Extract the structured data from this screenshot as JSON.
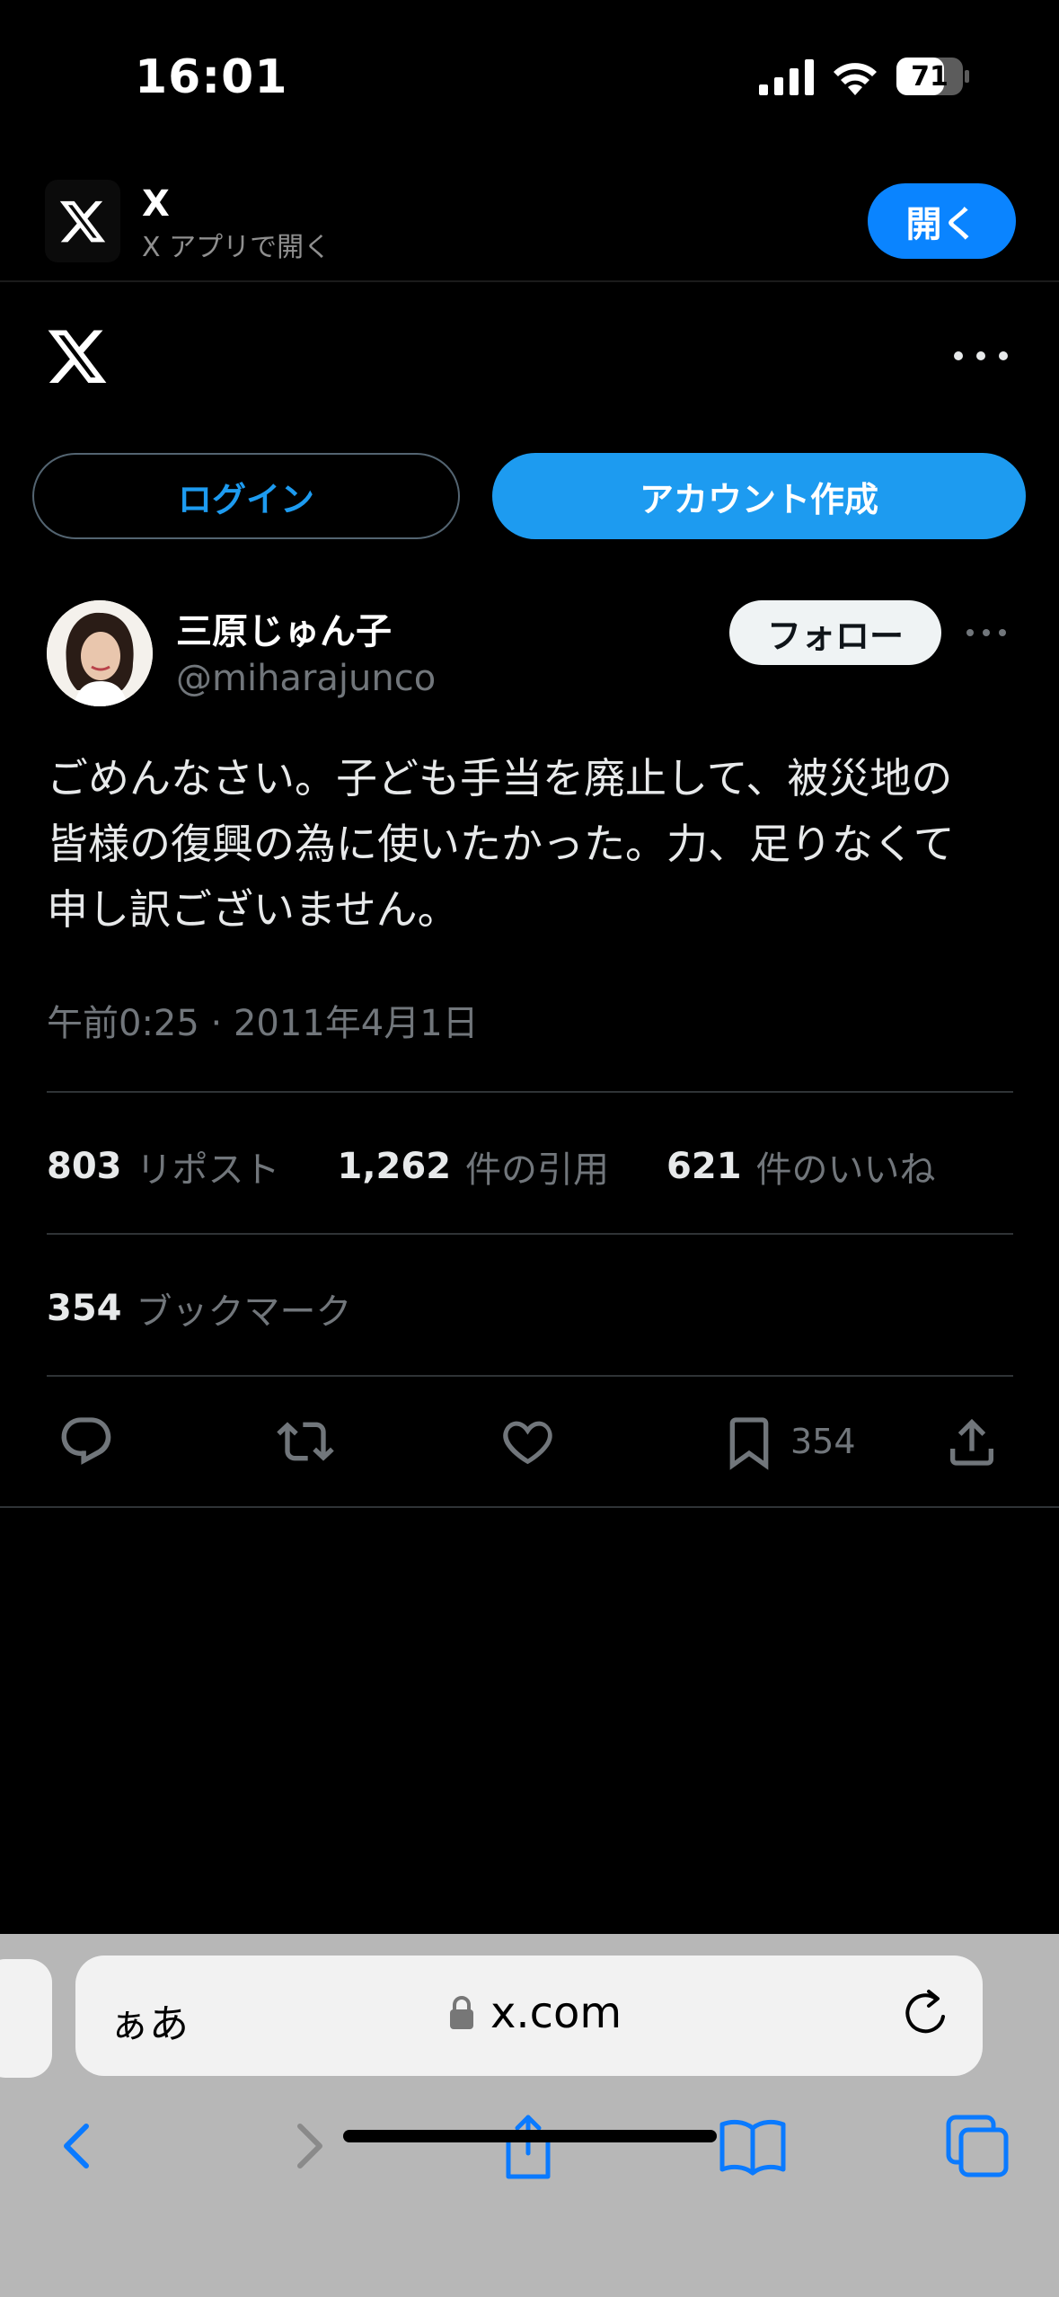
{
  "status_bar": {
    "time": "16:01",
    "battery": "71"
  },
  "app_banner": {
    "title": "X",
    "subtitle": "X アプリで開く",
    "open_label": "開く"
  },
  "header": {
    "login_label": "ログイン",
    "signup_label": "アカウント作成"
  },
  "tweet": {
    "author_name": "三原じゅん子",
    "author_handle": "@miharajunco",
    "follow_label": "フォロー",
    "text": "ごめんなさい。子ども手当を廃止して、被災地の\n皆様の復興の為に使いたかった。力、足りなくて\n申し訳ございません。",
    "timestamp": "午前0:25 · 2011年4月1日",
    "stats": {
      "reposts": {
        "count": "803",
        "label": "リポスト"
      },
      "quotes": {
        "count": "1,262",
        "label": "件の引用"
      },
      "likes": {
        "count": "621",
        "label": "件のいいね"
      },
      "bookmarks": {
        "count": "354",
        "label": "ブックマーク"
      }
    },
    "action_bookmark_count": "354"
  },
  "safari": {
    "aa_label": "ぁあ",
    "url": "x.com"
  },
  "colors": {
    "accent": "#1d9bf0",
    "banner_button": "#0a84ff",
    "background": "#000000",
    "safari_bar": "#b7b7b7"
  }
}
